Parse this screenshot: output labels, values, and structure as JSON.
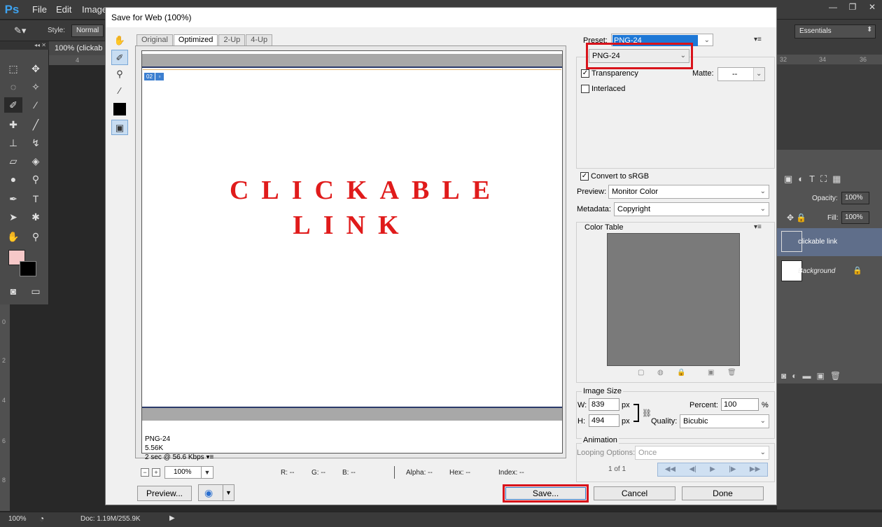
{
  "app": {
    "logo": "Ps",
    "menu": [
      "File",
      "Edit",
      "Image"
    ],
    "window_controls": [
      "—",
      "❐",
      "✕"
    ],
    "options_bar": {
      "style_label": "Style:",
      "style_value": "Normal"
    },
    "doc_tab": "100% (clickab",
    "workspace": "Essentials",
    "ruler_top": [
      "4"
    ],
    "ruler_right": [
      "32",
      "34",
      "36"
    ],
    "ruler_left": [
      "0",
      "2",
      "4",
      "6",
      "8"
    ],
    "layers": {
      "opacity_label": "Opacity:",
      "opacity_value": "100%",
      "fill_label": "Fill:",
      "fill_value": "100%",
      "items": [
        {
          "name": "clickable link",
          "selected": true
        },
        {
          "name": "Background",
          "selected": false
        }
      ]
    },
    "status": {
      "zoom": "100%",
      "doc": "Doc: 1.19M/255.9K"
    }
  },
  "dialog": {
    "title": "Save for Web (100%)",
    "view_tabs": [
      "Original",
      "Optimized",
      "2-Up",
      "4-Up"
    ],
    "active_tab": "Optimized",
    "slice_badge": "02",
    "image_text_line1": "CLICKABLE",
    "image_text_line2": "LINK",
    "image_color": "#e01b1b",
    "image_info": {
      "format": "PNG-24",
      "size": "5.56K",
      "time": "2 sec @ 56.6 Kbps"
    },
    "zoom": "100%",
    "readouts": {
      "r": "R: --",
      "g": "G: --",
      "b": "B: --",
      "alpha": "Alpha: --",
      "hex": "Hex: --",
      "index": "Index: --"
    },
    "preview_button": "Preview...",
    "save_button": "Save...",
    "cancel_button": "Cancel",
    "done_button": "Done",
    "settings": {
      "preset_label": "Preset:",
      "preset_value": "PNG-24",
      "format_value": "PNG-24",
      "transparency_label": "Transparency",
      "transparency_checked": true,
      "interlaced_label": "Interlaced",
      "interlaced_checked": false,
      "matte_label": "Matte:",
      "matte_value": "--",
      "convert_srgb_label": "Convert to sRGB",
      "convert_srgb_checked": true,
      "preview_label": "Preview:",
      "preview_value": "Monitor Color",
      "metadata_label": "Metadata:",
      "metadata_value": "Copyright"
    },
    "color_table": {
      "title": "Color Table",
      "swatch_color": "#7a7a7a"
    },
    "image_size": {
      "title": "Image Size",
      "w_label": "W:",
      "w_value": "839",
      "h_label": "H:",
      "h_value": "494",
      "unit": "px",
      "percent_label": "Percent:",
      "percent_value": "100",
      "percent_unit": "%",
      "quality_label": "Quality:",
      "quality_value": "Bicubic"
    },
    "animation": {
      "title": "Animation",
      "looping_label": "Looping Options:",
      "looping_value": "Once",
      "frame_counter": "1 of 1"
    },
    "highlight_color": "#d9131b"
  }
}
